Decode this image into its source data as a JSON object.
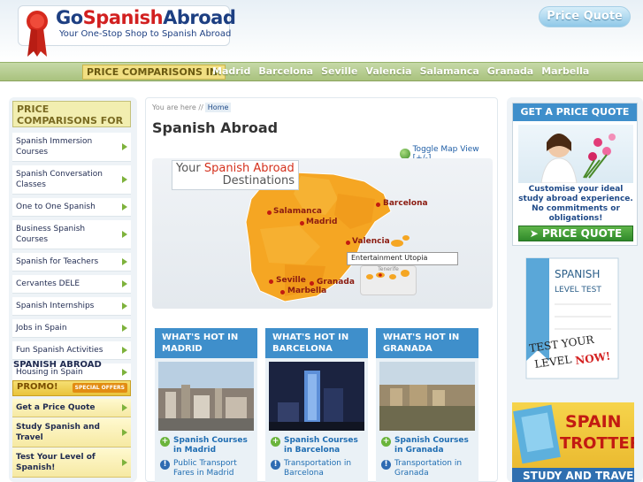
{
  "header": {
    "logo": {
      "go": "Go",
      "spanish": "Spanish",
      "abroad": "Abroad",
      "tagline": "Your One-Stop Shop to Spanish Abroad"
    },
    "price_quote_button": "Price Quote"
  },
  "nav": {
    "label": "PRICE COMPARISONS IN:",
    "links": [
      "Madrid",
      "Barcelona",
      "Seville",
      "Valencia",
      "Salamanca",
      "Granada",
      "Marbella"
    ]
  },
  "sidebar": {
    "heading": "PRICE COMPARISONS FOR",
    "items": [
      "Spanish Immersion Courses",
      "Spanish Conversation Classes",
      "One to One Spanish",
      "Business Spanish Courses",
      "Spanish for Teachers",
      "Cervantes DELE",
      "Spanish Internships",
      "Jobs in Spain",
      "Fun Spanish Activities",
      "Housing in Spain"
    ],
    "section_title": "SPANISH ABROAD",
    "promo": {
      "label": "PROMO!",
      "badge": "SPECIAL OFFERS"
    },
    "promo_items": [
      "Get a Price Quote",
      "Study Spanish and Travel",
      "Test Your Level of Spanish!"
    ]
  },
  "main": {
    "breadcrumb_prefix": "You are here //",
    "breadcrumb_home": "Home",
    "title": "Spanish Abroad",
    "toggle_map": "Toggle Map View [+/-]",
    "map": {
      "heading_your": "Your",
      "heading_spanish_abroad": "Spanish Abroad",
      "heading_destinations": "Destinations",
      "cities": [
        "Salamanca",
        "Madrid",
        "Barcelona",
        "Valencia",
        "Seville",
        "Granada",
        "Marbella"
      ],
      "tooltip": "Entertainment Utopia",
      "inset_label": "Tenerife"
    },
    "hot_boxes": [
      {
        "title": "WHAT'S HOT IN MADRID",
        "link1": "Spanish Courses in Madrid",
        "link2": "Public Transport Fares in Madrid"
      },
      {
        "title": "WHAT'S HOT IN BARCELONA",
        "link1": "Spanish Courses in Barcelona",
        "link2": "Transportation in Barcelona"
      },
      {
        "title": "WHAT'S HOT IN GRANADA",
        "link1": "Spanish Courses in Granada",
        "link2": "Transportation in Granada"
      }
    ]
  },
  "right": {
    "quote_title": "GET A PRICE QUOTE",
    "quote_text": "Customise your ideal study abroad experience. No commitments or obligations!",
    "quote_button": "PRICE QUOTE",
    "level_test": {
      "line1": "SPANISH",
      "line2": "LEVEL TEST",
      "line3": "TEST YOUR",
      "line4": "LEVEL",
      "line5": "NOW!"
    },
    "trotter": {
      "line1": "SPAIN",
      "line2": "TROTTER",
      "line3": "STUDY AND TRAVEL"
    }
  },
  "colors": {
    "brand_blue": "#1d3f82",
    "brand_red": "#d22020",
    "nav_green": "#a9c27e",
    "panel_blue": "#3f8fcb",
    "map_orange": "#f5a623"
  }
}
